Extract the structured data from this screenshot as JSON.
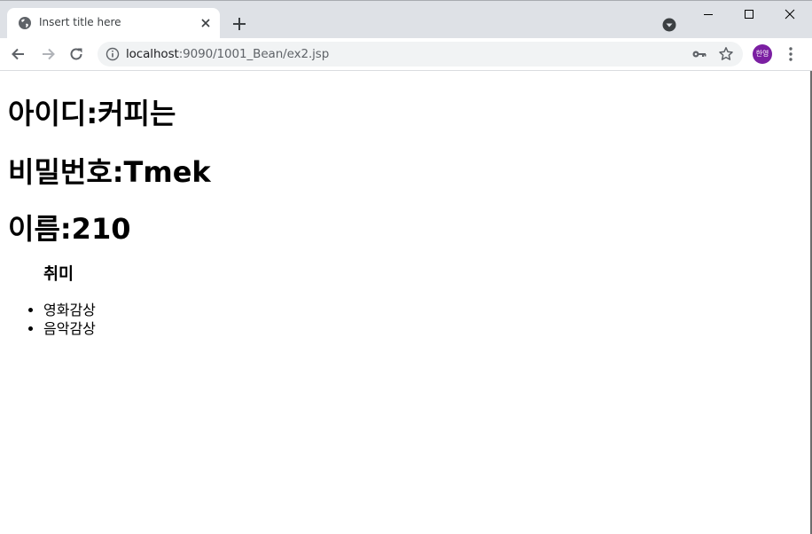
{
  "browser": {
    "tab_title": "Insert title here",
    "avatar_text": "한영",
    "url_host": "localhost",
    "url_rest": ":9090/1001_Bean/ex2.jsp",
    "accent_color": "#7b1fa2"
  },
  "page": {
    "id_line": "아이디:커피는",
    "password_line": "비밀번호:Tmek",
    "name_line": "이름:210",
    "hobby_heading": "취미",
    "hobbies": [
      "영화감상",
      "음악감상"
    ]
  }
}
